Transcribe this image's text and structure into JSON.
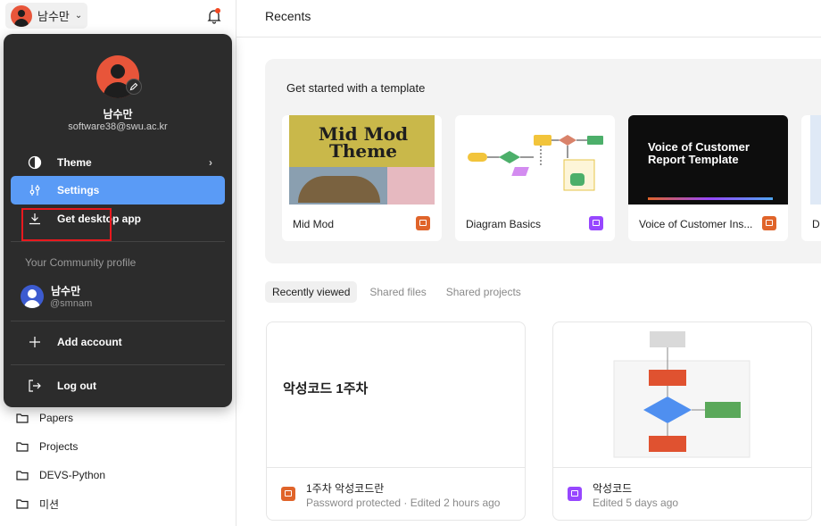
{
  "sidebar": {
    "user_name": "남수만",
    "folders": [
      {
        "label": "Papers"
      },
      {
        "label": "Projects"
      },
      {
        "label": "DEVS-Python"
      },
      {
        "label": "미션"
      }
    ]
  },
  "main": {
    "title": "Recents",
    "templates": {
      "heading": "Get started with a template",
      "items": [
        {
          "name": "Mid Mod",
          "type": "slides",
          "thumb_text": "Mid Mod Theme"
        },
        {
          "name": "Diagram Basics",
          "type": "figjam"
        },
        {
          "name": "Voice of Customer Ins...",
          "type": "slides",
          "thumb_text": "Voice of Customer Report Template"
        },
        {
          "name": "D",
          "type": "other"
        }
      ]
    },
    "tabs": [
      {
        "label": "Recently viewed",
        "active": true
      },
      {
        "label": "Shared files",
        "active": false
      },
      {
        "label": "Shared projects",
        "active": false
      }
    ],
    "files": [
      {
        "thumb_text": "악성코드 1주차",
        "name": "1주차 악성코드란",
        "meta": "Password protected · Edited 2 hours ago",
        "type": "slides"
      },
      {
        "name": "악성코드",
        "meta": "Edited 5 days ago",
        "type": "figjam"
      }
    ]
  },
  "menu": {
    "name": "남수만",
    "email": "software38@swu.ac.kr",
    "items": {
      "theme": "Theme",
      "settings": "Settings",
      "desktop": "Get desktop app",
      "add_account": "Add account",
      "logout": "Log out"
    },
    "community": {
      "section_label": "Your Community profile",
      "name": "남수만",
      "handle": "@smnam"
    }
  },
  "colors": {
    "accent": "#5a9bf6",
    "highlight": "#e8191e",
    "avatar": "#e8553a",
    "slides": "#e0642a",
    "figjam": "#9747ff"
  }
}
